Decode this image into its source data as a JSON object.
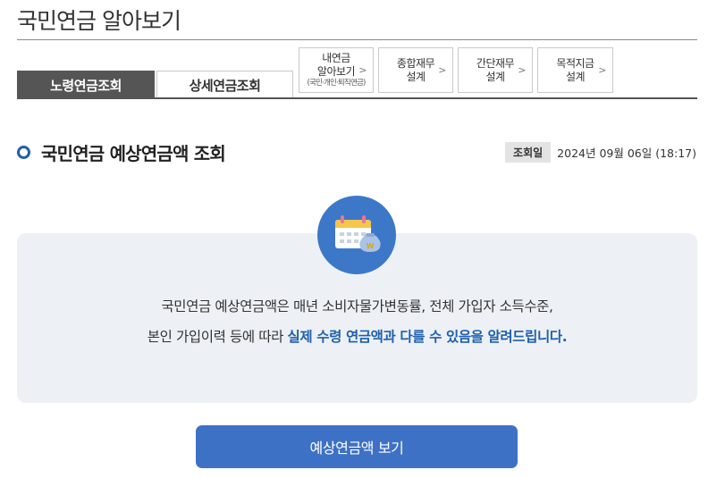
{
  "header": {
    "title": "국민연금 알아보기"
  },
  "tabs": [
    {
      "label": "노령연금조회"
    },
    {
      "label": "상세연금조회"
    }
  ],
  "links": [
    {
      "line1": "내연금",
      "line2": "알아보기",
      "sub": "(국민·개인·퇴직연금)"
    },
    {
      "line1": "종합재무",
      "line2": "설계"
    },
    {
      "line1": "간단재무",
      "line2": "설계"
    },
    {
      "line1": "목적지금",
      "line2": "설계"
    }
  ],
  "section": {
    "title": "국민연금 예상연금액 조회",
    "query_label": "조회일",
    "query_value": "2024년 09월 06일 (18:17)"
  },
  "info": {
    "line1": "국민연금 예상연금액은 매년 소비자물가변동률, 전체 가입자 소득수준,",
    "line2_plain": "본인 가입이력 등에 따라 ",
    "line2_highlight": "실제 수령 연금액과 다를 수 있음을 알려드립니다.",
    "icon_name": "calendar-coin-icon"
  },
  "button": {
    "label": "예상연금액 보기"
  },
  "colors": {
    "accent": "#1f5fae",
    "button": "#3d71c5",
    "active_tab": "#555555",
    "info_bg": "#edf1f5"
  }
}
